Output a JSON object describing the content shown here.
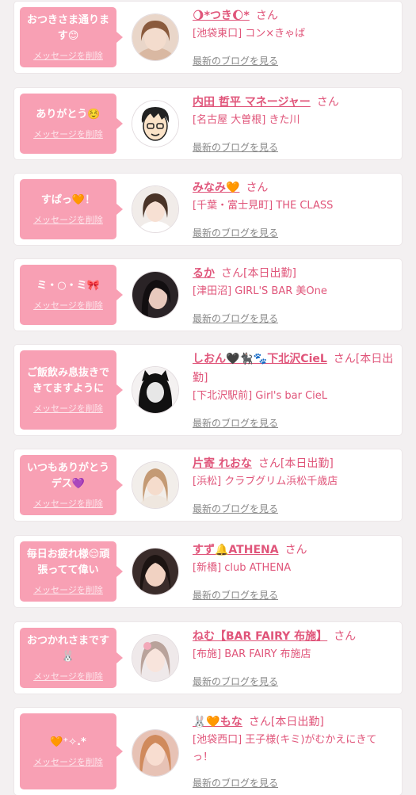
{
  "colors": {
    "accent": "#e0557a",
    "bubble": "#f8a0b4",
    "background": "#f3f0f1"
  },
  "entries": [
    {
      "message": "おつきさま通ります😊",
      "delete_label": "メッセージを削除",
      "name": "🌖*つき🌔*",
      "suffix": "さん",
      "shop": "[池袋東口] コン×きゃば",
      "blog_label": "最新のブログを見る"
    },
    {
      "message": "ありがとう☺️",
      "delete_label": "メッセージを削除",
      "name": "内田 哲平 マネージャー",
      "suffix": "さん",
      "shop": "[名古屋 大曽根] きた川",
      "blog_label": "最新のブログを見る"
    },
    {
      "message": "すぱっ🧡！",
      "delete_label": "メッセージを削除",
      "name": "みなみ🧡",
      "suffix": "さん",
      "shop": "[千葉・富士見町] THE CLASS",
      "blog_label": "最新のブログを見る"
    },
    {
      "message": "ミ・○・ミ🎀",
      "delete_label": "メッセージを削除",
      "name": "るか",
      "suffix": "さん[本日出勤]",
      "shop": "[津田沼] GIRL'S BAR 美One",
      "blog_label": "最新のブログを見る"
    },
    {
      "message": "ご飯飲み息抜きできてますように",
      "delete_label": "メッセージを削除",
      "name": "しおん🖤🐈‍⬛🐾下北沢CieL",
      "suffix": "さん[本日出勤]",
      "shop": "[下北沢駅前] Girl's bar CieL",
      "blog_label": "最新のブログを見る"
    },
    {
      "message": "いつもありがとうデス💜",
      "delete_label": "メッセージを削除",
      "name": "片寄 れおな",
      "suffix": "さん[本日出勤]",
      "shop": "[浜松] クラブグリム浜松千歳店",
      "blog_label": "最新のブログを見る"
    },
    {
      "message": "毎日お疲れ様😌頑張ってて偉い",
      "delete_label": "メッセージを削除",
      "name": "すず🔔ATHENA",
      "suffix": "さん",
      "shop": "[新橋] club ATHENA",
      "blog_label": "最新のブログを見る"
    },
    {
      "message": "おつかれさまです🐰",
      "delete_label": "メッセージを削除",
      "name": "ねむ【BAR FAIRY 布施】",
      "suffix": "さん",
      "shop": "[布施] BAR FAIRY 布施店",
      "blog_label": "最新のブログを見る"
    },
    {
      "message": "🧡⁺✧.*",
      "delete_label": "メッセージを削除",
      "name": "🐰🧡もな",
      "suffix": "さん[本日出勤]",
      "shop": "[池袋西口] 王子様(キミ)がむかえにきてっ！",
      "blog_label": "最新のブログを見る"
    }
  ]
}
